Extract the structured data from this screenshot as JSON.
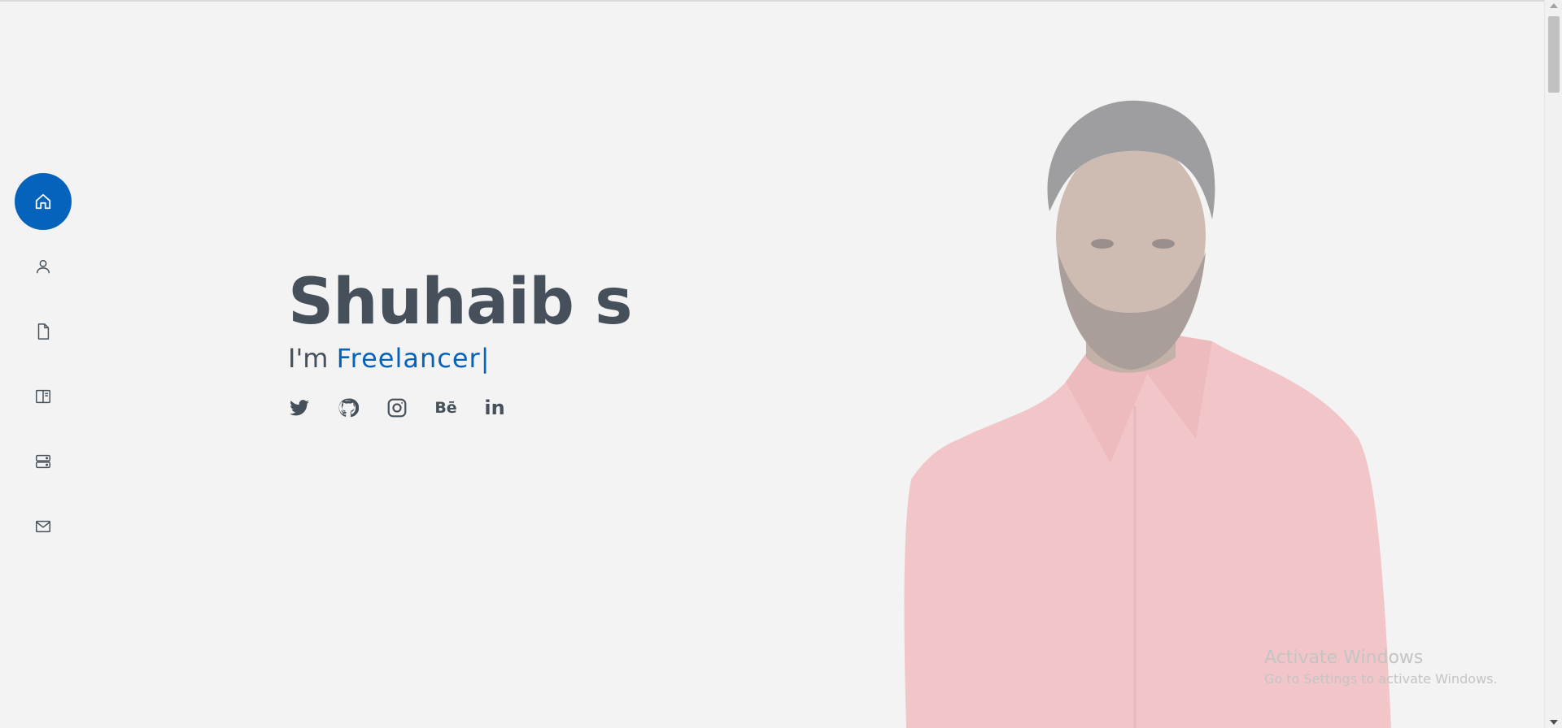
{
  "sidebar": {
    "items": [
      {
        "name": "home",
        "icon": "house-icon",
        "active": true
      },
      {
        "name": "about",
        "icon": "person-icon",
        "active": false
      },
      {
        "name": "resume",
        "icon": "file-icon",
        "active": false
      },
      {
        "name": "portfolio",
        "icon": "book-half-icon",
        "active": false
      },
      {
        "name": "services",
        "icon": "server-icon",
        "active": false
      },
      {
        "name": "contact",
        "icon": "envelope-icon",
        "active": false
      }
    ],
    "accent_color": "#0563bb"
  },
  "hero": {
    "name": "Shuhaib s",
    "prefix": "I'm",
    "typed_text": "Freelancer",
    "cursor": "|"
  },
  "social": {
    "links": [
      {
        "name": "twitter",
        "icon": "twitter-icon"
      },
      {
        "name": "github",
        "icon": "github-icon"
      },
      {
        "name": "instagram",
        "icon": "instagram-icon"
      },
      {
        "name": "behance",
        "icon": "behance-icon",
        "glyph": "Bē"
      },
      {
        "name": "linkedin",
        "icon": "linkedin-icon",
        "glyph": "in"
      }
    ]
  },
  "watermark": {
    "title": "Activate Windows",
    "subtitle": "Go to Settings to activate Windows."
  },
  "colors": {
    "background": "#f3f3f3",
    "text": "#45505b",
    "accent": "#0563bb"
  }
}
